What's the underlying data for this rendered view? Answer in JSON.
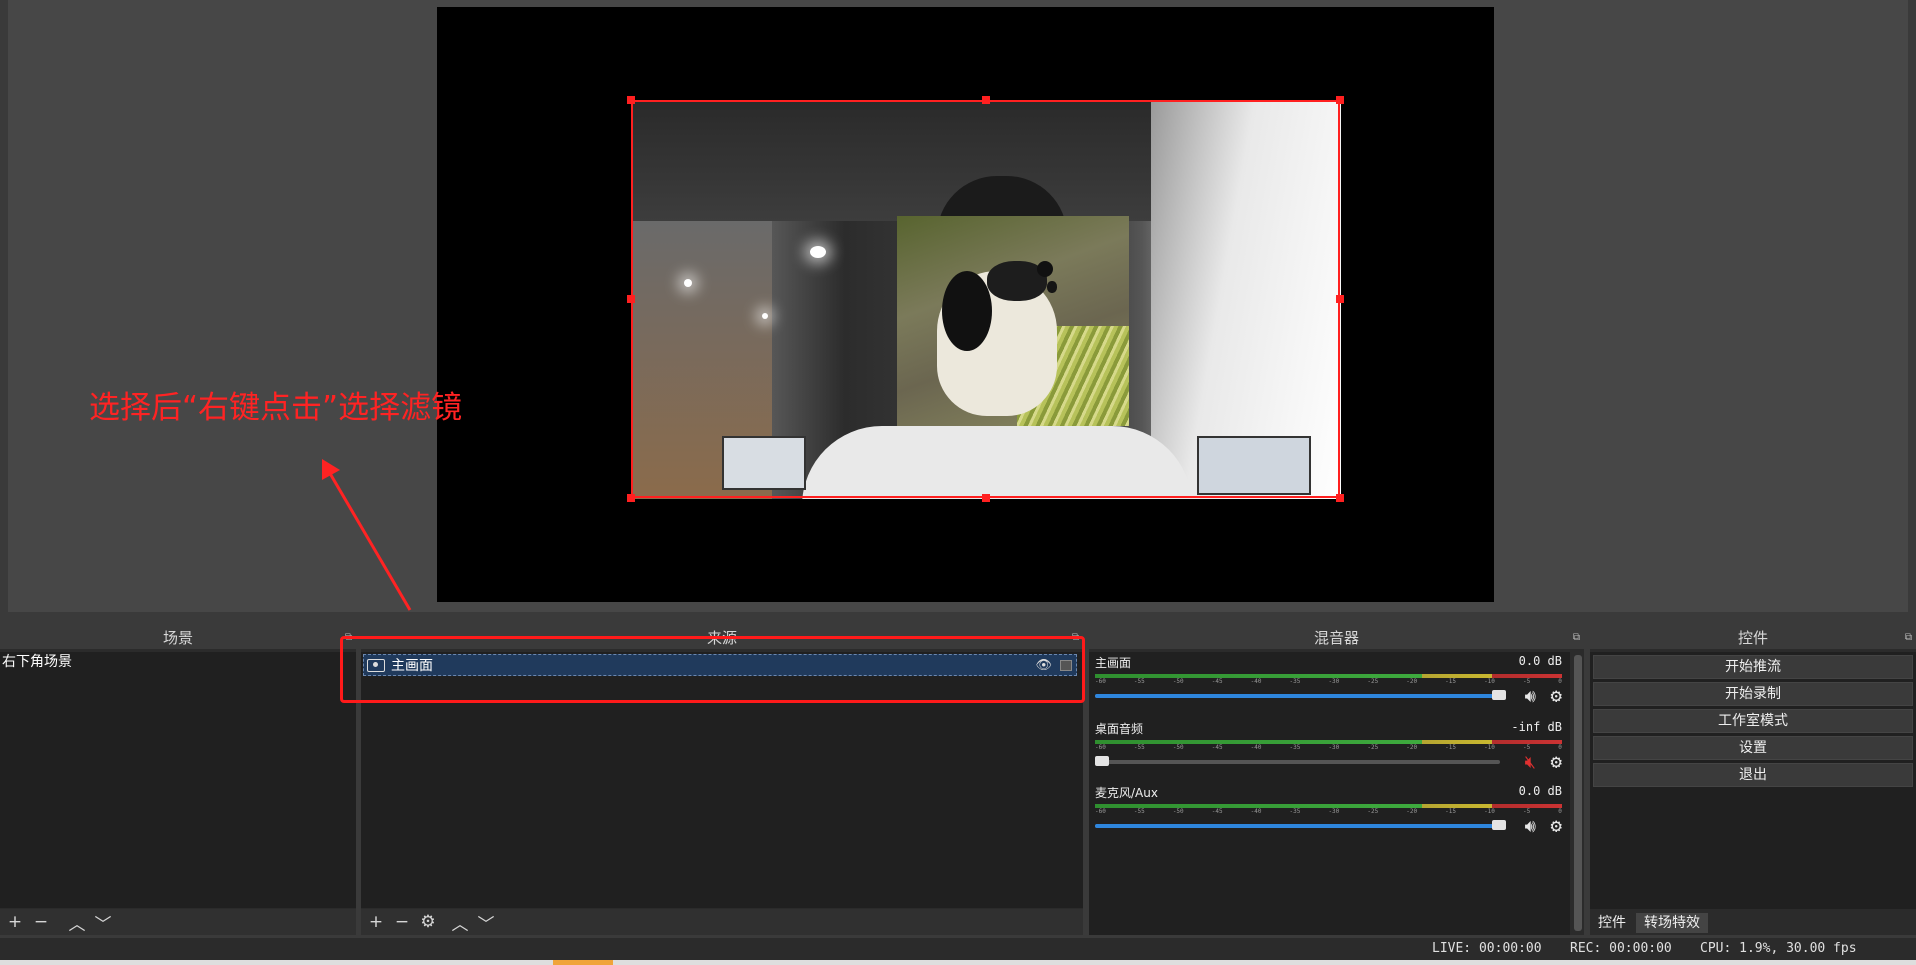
{
  "annotation": {
    "text": "选择后“右键点击”选择滤镜"
  },
  "colors": {
    "annotation": "#ff2323",
    "selection": "#ff2020",
    "accent_blue": "#2e86de"
  },
  "docks": {
    "scenes": {
      "title": "场景",
      "items": [
        "右下角场景"
      ]
    },
    "sources": {
      "title": "来源",
      "items": [
        {
          "label": "主画面",
          "icon": "camera-icon"
        }
      ]
    },
    "mixer": {
      "title": "混音器",
      "channels": [
        {
          "name": "主画面",
          "db": "0.0 dB",
          "volume": 1.0,
          "muted": false
        },
        {
          "name": "桌面音频",
          "db": "-inf dB",
          "volume": 0.0,
          "muted": true
        },
        {
          "name": "麦克风/Aux",
          "db": "0.0 dB",
          "volume": 1.0,
          "muted": false
        }
      ],
      "ticks": [
        "-60",
        "-55",
        "-50",
        "-45",
        "-40",
        "-35",
        "-30",
        "-25",
        "-20",
        "-15",
        "-10",
        "-5",
        "0"
      ]
    },
    "controls": {
      "title": "控件",
      "buttons": [
        "开始推流",
        "开始录制",
        "工作室模式",
        "设置",
        "退出"
      ],
      "tabs": [
        "控件",
        "转场特效"
      ]
    }
  },
  "status": {
    "live": "LIVE: 00:00:00",
    "rec": "REC: 00:00:00",
    "cpu": "CPU: 1.9%, 30.00 fps"
  }
}
